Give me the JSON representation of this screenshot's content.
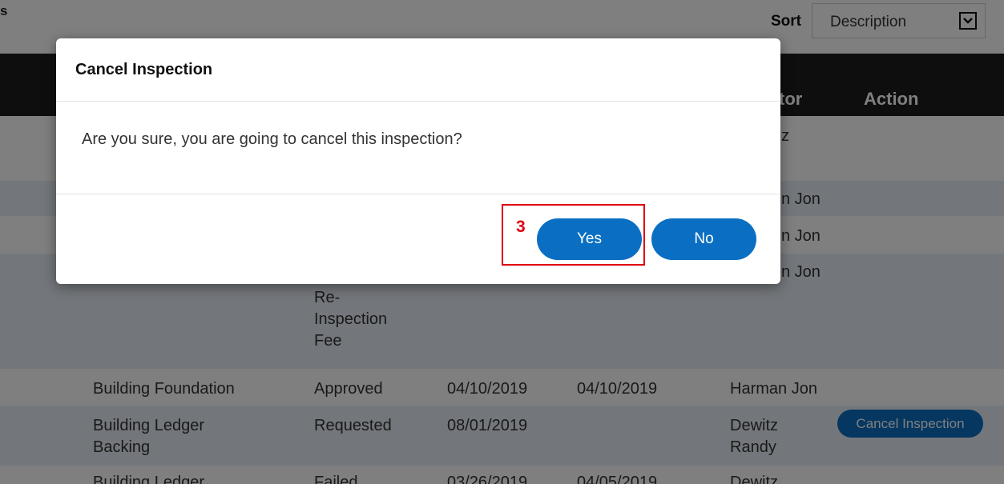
{
  "page": {
    "title_fragment": "s"
  },
  "sort": {
    "label": "Sort",
    "selected": "Description"
  },
  "table": {
    "headers": {
      "inspector_partial": "tor",
      "action": "Action"
    },
    "rows": [
      {
        "inspector": "z"
      },
      {
        "inspector": "n Jon"
      },
      {
        "inspector": "n Jon"
      },
      {
        "inspector": "n Jon",
        "status_lines": [
          "Re-",
          "Inspection",
          "Fee"
        ]
      },
      {
        "description": "Building Foundation",
        "status": "Approved",
        "requested": "04/10/2019",
        "completed": "04/10/2019",
        "inspector": "Harman Jon"
      },
      {
        "description_lines": [
          "Building Ledger",
          "Backing"
        ],
        "status": "Requested",
        "requested": "08/01/2019",
        "inspector_lines": [
          "Dewitz",
          "Randy"
        ],
        "action": "Cancel Inspection"
      },
      {
        "description": "Building Ledger",
        "status": "Failed",
        "requested": "03/26/2019",
        "completed": "04/05/2019",
        "inspector": "Dewitz"
      }
    ]
  },
  "modal": {
    "title": "Cancel Inspection",
    "message": "Are you sure, you are going to cancel this inspection?",
    "yes_label": "Yes",
    "no_label": "No"
  },
  "annotation": {
    "step": "3"
  },
  "colors": {
    "primary_button": "#0a6fc2",
    "header_bg": "#1c1c1c",
    "highlight": "#e0000f",
    "row_tint": "#e6eef7"
  }
}
